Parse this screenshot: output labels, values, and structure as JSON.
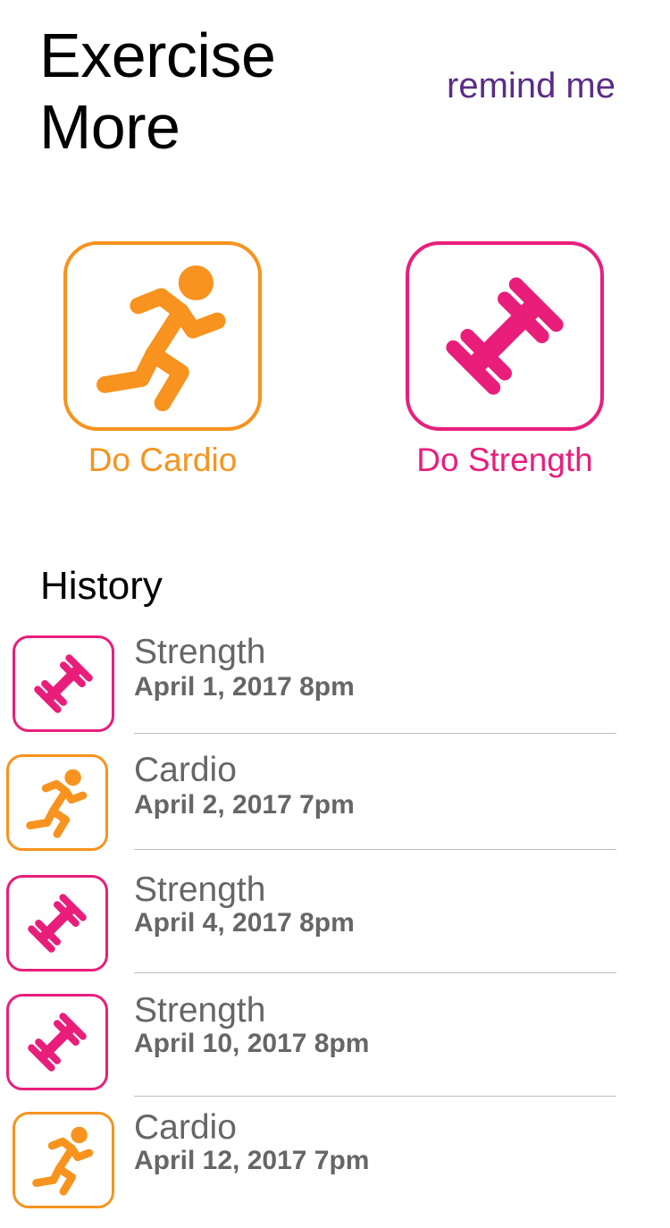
{
  "header": {
    "title_line1": "Exercise",
    "title_line2": "More",
    "remind_label": "remind me"
  },
  "colors": {
    "cardio": "#f7931e",
    "strength": "#e91e7b",
    "remind": "#5b2c87",
    "history_text": "#666666"
  },
  "actions": [
    {
      "label": "Do Cardio",
      "icon": "running-person-icon"
    },
    {
      "label": "Do Strength",
      "icon": "dumbbell-icon"
    }
  ],
  "history": {
    "heading": "History",
    "items": [
      {
        "type": "Strength",
        "date": "April 1, 2017 8pm",
        "icon": "dumbbell-icon"
      },
      {
        "type": "Cardio",
        "date": "April 2, 2017 7pm",
        "icon": "running-person-icon"
      },
      {
        "type": "Strength",
        "date": "April 4, 2017 8pm",
        "icon": "dumbbell-icon"
      },
      {
        "type": "Strength",
        "date": "April 10, 2017 8pm",
        "icon": "dumbbell-icon"
      },
      {
        "type": "Cardio",
        "date": "April 12, 2017 7pm",
        "icon": "running-person-icon"
      }
    ]
  }
}
